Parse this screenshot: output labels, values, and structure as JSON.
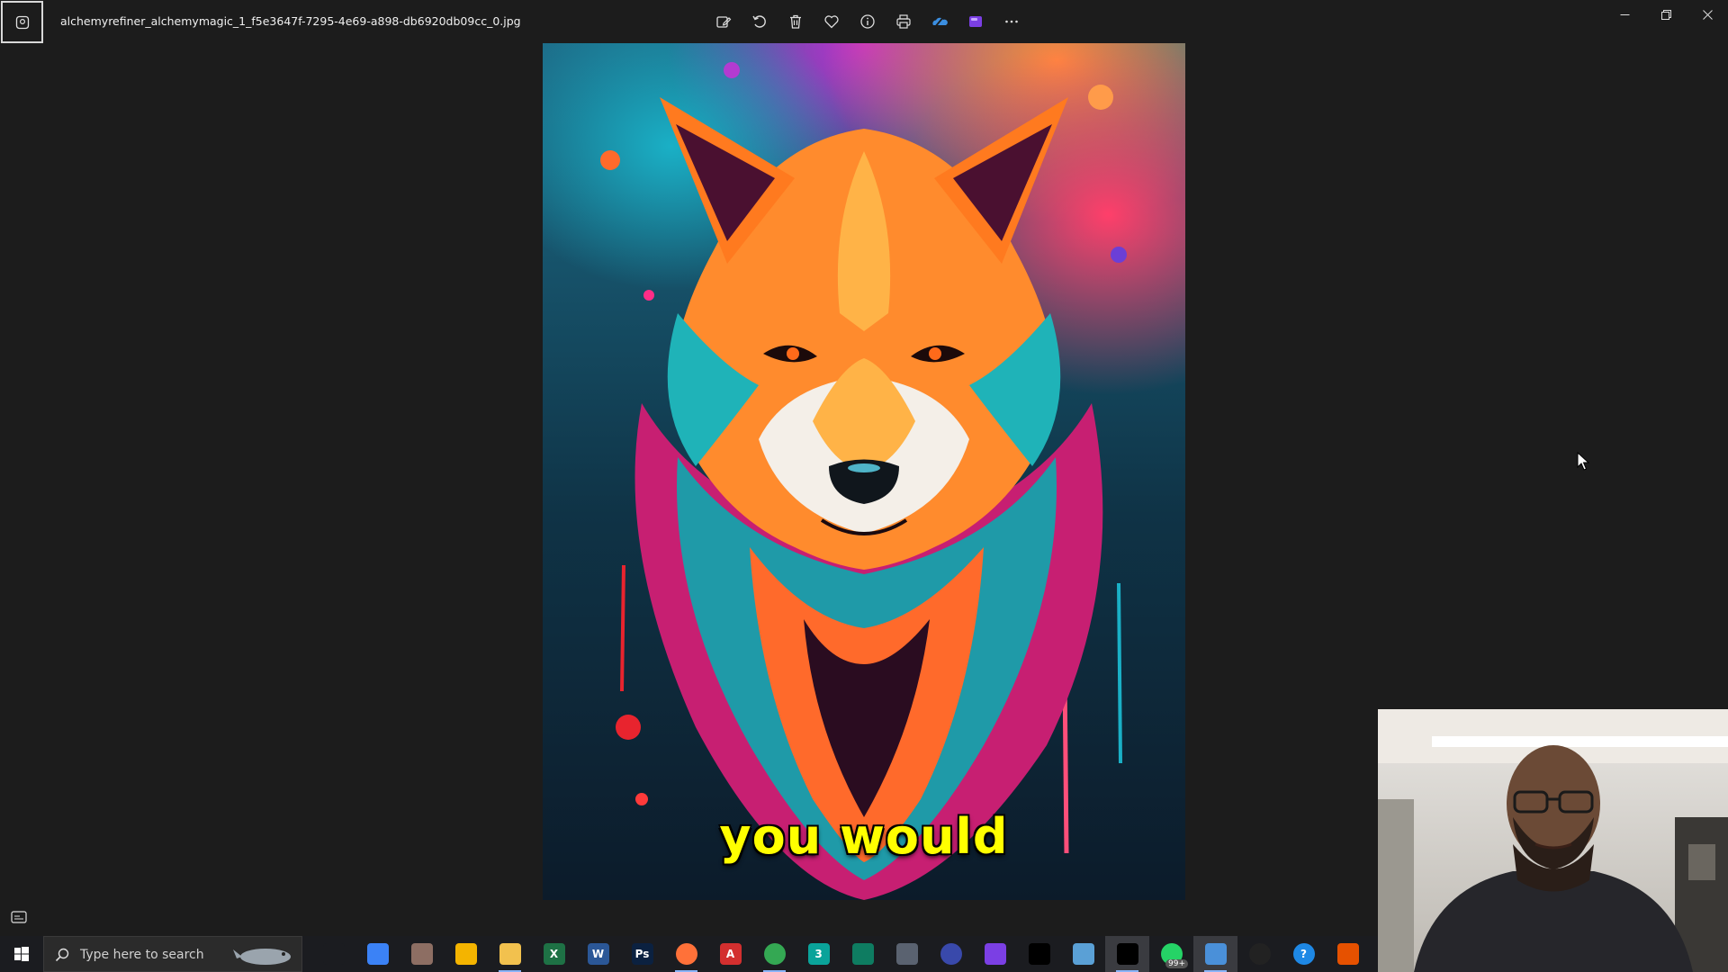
{
  "titlebar": {
    "filename": "alchemyrefiner_alchemymagic_1_f5e3647f-7295-4e69-a898-db6920db09cc_0.jpg",
    "toolbar_icons": [
      "edit-image-icon",
      "rotate-icon",
      "delete-icon",
      "favorite-icon",
      "info-icon",
      "print-icon",
      "onedrive-icon",
      "clipchamp-icon",
      "more-icon"
    ],
    "window_controls": [
      "minimize-icon",
      "restore-icon",
      "close-icon"
    ]
  },
  "viewer": {
    "caption": "you would"
  },
  "taskbar": {
    "search_placeholder": "Type here to search",
    "apps": [
      {
        "name": "task-view",
        "label": "",
        "color": "#1b1c20"
      },
      {
        "name": "copilot",
        "label": "",
        "color": "#3b82f6"
      },
      {
        "name": "paint",
        "label": "",
        "color": "#8d6e63"
      },
      {
        "name": "media-player",
        "label": "",
        "color": "#f4b400"
      },
      {
        "name": "file-explorer",
        "label": "",
        "color": "#f2c14e"
      },
      {
        "name": "excel",
        "label": "X",
        "color": "#1e7145"
      },
      {
        "name": "word",
        "label": "W",
        "color": "#2b5797"
      },
      {
        "name": "photoshop",
        "label": "Ps",
        "color": "#0b2140"
      },
      {
        "name": "firefox",
        "label": "",
        "color": "#ff7139"
      },
      {
        "name": "acrobat",
        "label": "A",
        "color": "#d32f2f"
      },
      {
        "name": "chrome",
        "label": "",
        "color": "#34a853"
      },
      {
        "name": "app-3",
        "label": "3",
        "color": "#0aa39a"
      },
      {
        "name": "app-green",
        "label": "",
        "color": "#0e7c61"
      },
      {
        "name": "calculator",
        "label": "",
        "color": "#5a6270"
      },
      {
        "name": "app-circle",
        "label": "",
        "color": "#3949ab"
      },
      {
        "name": "clipchamp",
        "label": "",
        "color": "#7b3fe4"
      },
      {
        "name": "capcut",
        "label": "",
        "color": "#000000"
      },
      {
        "name": "notepad",
        "label": "",
        "color": "#5aa0d6"
      },
      {
        "name": "capcut-2",
        "label": "",
        "color": "#000000"
      },
      {
        "name": "whatsapp",
        "label": "",
        "color": "#25d366",
        "badge": "99+"
      },
      {
        "name": "photos",
        "label": "",
        "color": "#4a90d9"
      },
      {
        "name": "obs",
        "label": "",
        "color": "#222222"
      },
      {
        "name": "help",
        "label": "?",
        "color": "#1e88e5"
      },
      {
        "name": "app-last",
        "label": "",
        "color": "#e65100"
      }
    ]
  }
}
